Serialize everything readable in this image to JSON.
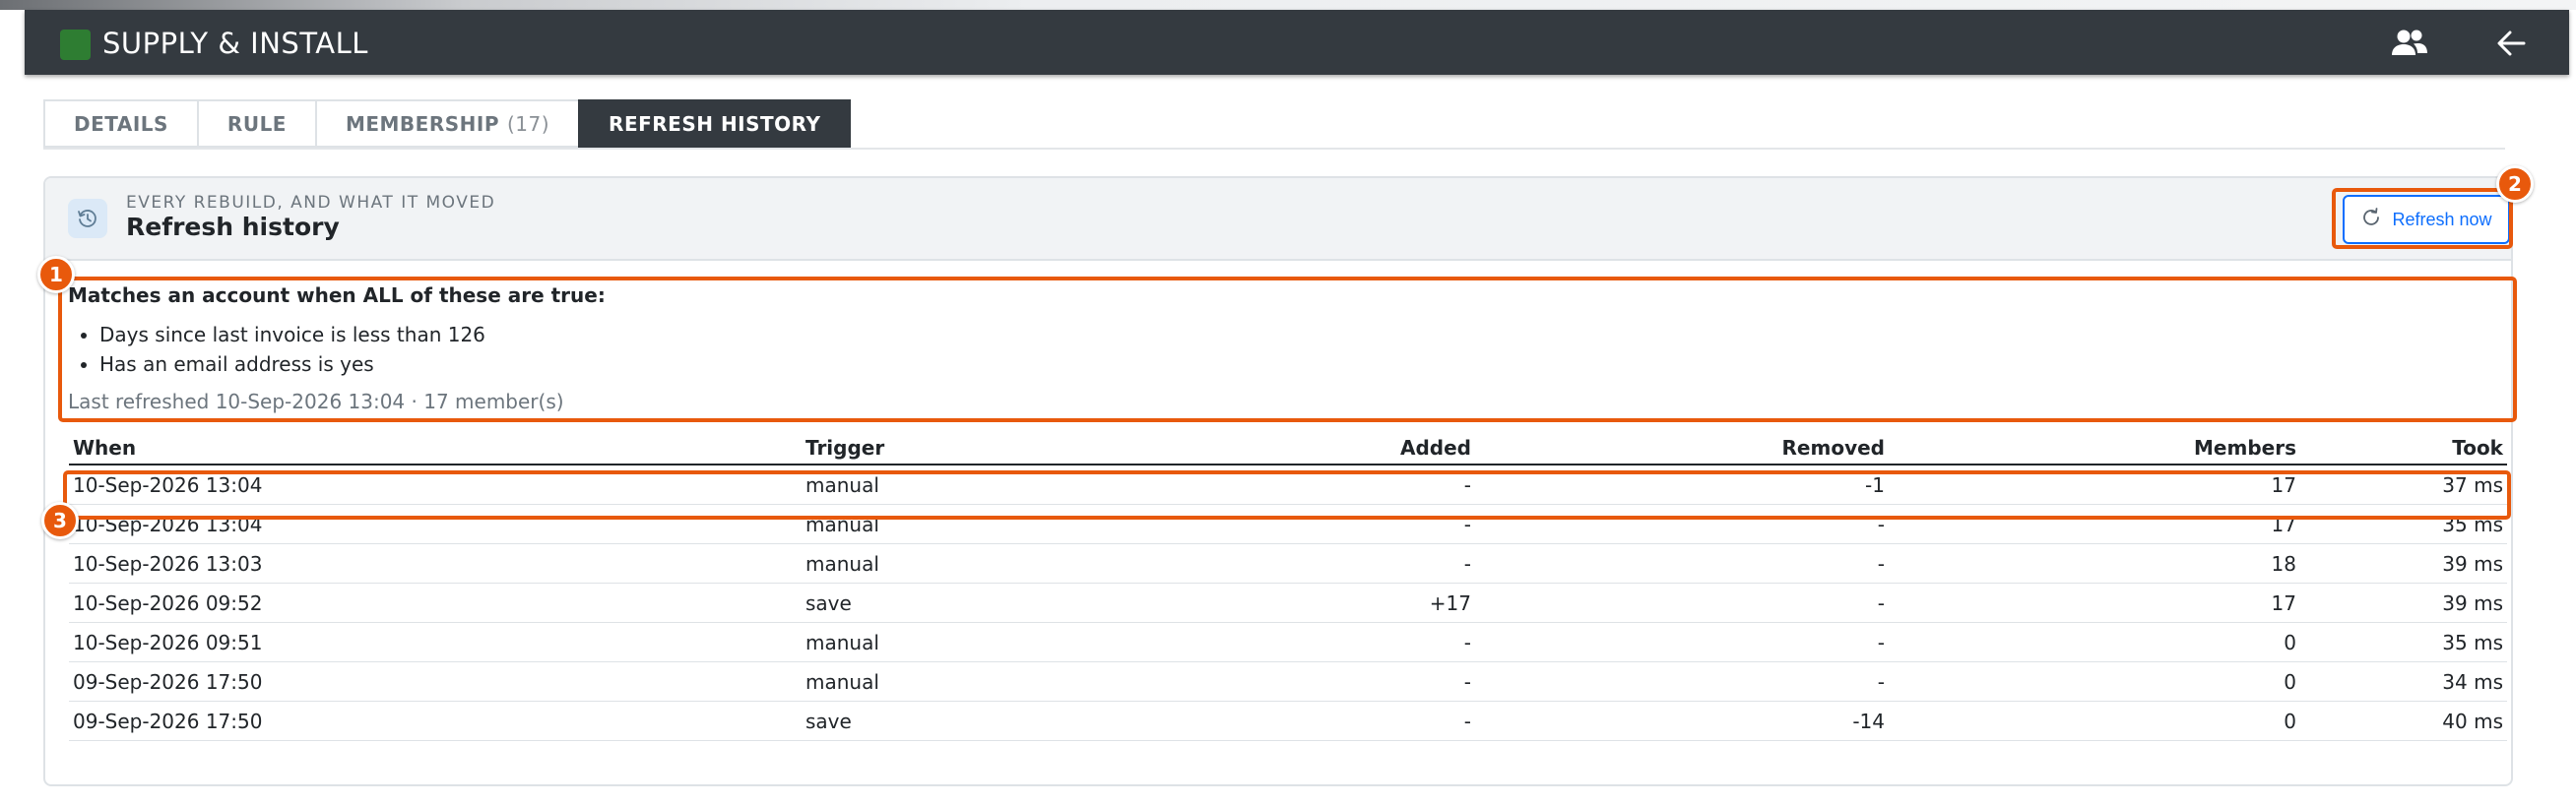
{
  "app": {
    "title": "SUPPLY & INSTALL",
    "brand_color": "#2e7d32",
    "header_bg": "#343a40",
    "icons": [
      "users-icon",
      "arrow-left-icon"
    ]
  },
  "tabs": [
    {
      "label": "DETAILS",
      "count": "",
      "active": false
    },
    {
      "label": "RULE",
      "count": "",
      "active": false
    },
    {
      "label": "MEMBERSHIP",
      "count": "(17)",
      "active": false
    },
    {
      "label": "REFRESH HISTORY",
      "count": "",
      "active": true
    }
  ],
  "panel": {
    "eyebrow": "EVERY REBUILD, AND WHAT IT MOVED",
    "title": "Refresh history",
    "icon": "history-icon",
    "refresh_button": {
      "label": "Refresh now",
      "icon": "refresh-icon",
      "color": "#0d6efd"
    }
  },
  "rule": {
    "heading": "Matches an account when ALL of these are true:",
    "conditions": [
      "Days since last invoice is less than 126",
      "Has an email address is yes"
    ],
    "last_refreshed": "Last refreshed 10-Sep-2026 13:04 · 17 member(s)"
  },
  "history": {
    "columns": [
      "When",
      "Trigger",
      "Added",
      "Removed",
      "Members",
      "Took"
    ],
    "rows": [
      {
        "when": "10-Sep-2026 13:04",
        "trigger": "manual",
        "added": "-",
        "removed": "-1",
        "members": "17",
        "took": "37 ms"
      },
      {
        "when": "10-Sep-2026 13:04",
        "trigger": "manual",
        "added": "-",
        "removed": "-",
        "members": "17",
        "took": "35 ms"
      },
      {
        "when": "10-Sep-2026 13:03",
        "trigger": "manual",
        "added": "-",
        "removed": "-",
        "members": "18",
        "took": "39 ms"
      },
      {
        "when": "10-Sep-2026 09:52",
        "trigger": "save",
        "added": "+17",
        "removed": "-",
        "members": "17",
        "took": "39 ms"
      },
      {
        "when": "10-Sep-2026 09:51",
        "trigger": "manual",
        "added": "-",
        "removed": "-",
        "members": "0",
        "took": "35 ms"
      },
      {
        "when": "09-Sep-2026 17:50",
        "trigger": "manual",
        "added": "-",
        "removed": "-",
        "members": "0",
        "took": "34 ms"
      },
      {
        "when": "09-Sep-2026 17:50",
        "trigger": "save",
        "added": "-",
        "removed": "-14",
        "members": "0",
        "took": "40 ms"
      }
    ]
  },
  "annotations": {
    "color": "#e8590c",
    "labels": [
      "1",
      "2",
      "3"
    ]
  }
}
